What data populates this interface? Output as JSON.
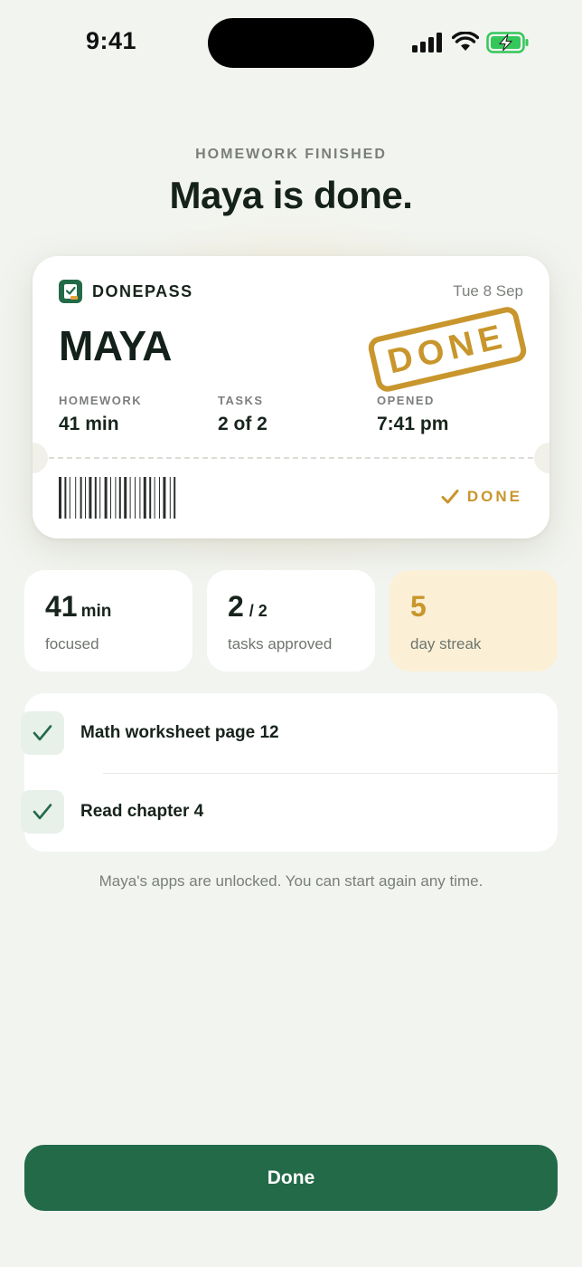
{
  "status_bar": {
    "time": "9:41"
  },
  "header": {
    "eyebrow": "HOMEWORK FINISHED",
    "title": "Maya is done."
  },
  "pass": {
    "brand": "DONEPASS",
    "date": "Tue 8 Sep",
    "name": "MAYA",
    "stamp": "DONE",
    "fields": [
      {
        "label": "HOMEWORK",
        "value": "41 min"
      },
      {
        "label": "TASKS",
        "value": "2 of 2"
      },
      {
        "label": "OPENED",
        "value": "7:41 pm"
      }
    ],
    "status": "DONE"
  },
  "stats": [
    {
      "value": "41",
      "unit": "min",
      "caption": "focused"
    },
    {
      "value": "2",
      "unit": "/ 2",
      "caption": "tasks approved"
    },
    {
      "value": "5",
      "unit": "",
      "caption": "day streak"
    }
  ],
  "tasks": [
    {
      "label": "Math worksheet page 12",
      "checked": true
    },
    {
      "label": "Read chapter 4",
      "checked": true
    }
  ],
  "footnote": "Maya's apps are unlocked. You can start again any time.",
  "primary_button": {
    "label": "Done"
  },
  "colors": {
    "brand_green": "#226a48",
    "gold": "#c8962c",
    "background": "#f2f4f0"
  }
}
